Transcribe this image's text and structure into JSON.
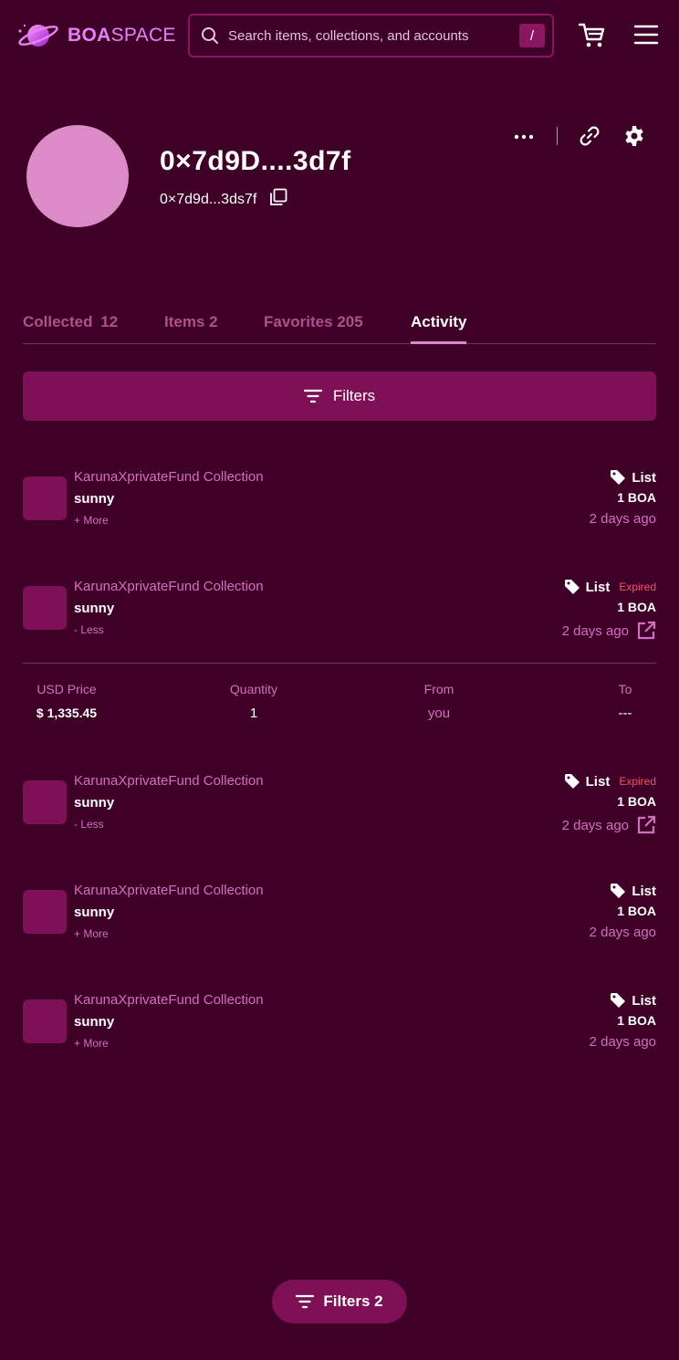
{
  "header": {
    "logo_bold": "BOA",
    "logo_light": "SPACE",
    "search_placeholder": "Search items, collections, and accounts",
    "search_shortcut": "/"
  },
  "profile": {
    "name": "0×7d9D....3d7f",
    "address": "0×7d9d...3ds7f"
  },
  "tabs": [
    {
      "label": "Collected",
      "count": "12"
    },
    {
      "label": "Items",
      "count": "2"
    },
    {
      "label": "Favorites",
      "count": "205"
    },
    {
      "label": "Activity",
      "count": ""
    }
  ],
  "filters_label": "Filters",
  "activity": [
    {
      "collection": "KarunaXprivateFund Collection",
      "name": "sunny",
      "toggle": "+ More",
      "event": "List",
      "status": "",
      "price": "1 BOA",
      "time": "2 days ago"
    },
    {
      "collection": "KarunaXprivateFund Collection",
      "name": "sunny",
      "toggle": "- Less",
      "event": "List",
      "status": "Expired",
      "price": "1 BOA",
      "time": "2 days ago"
    },
    {
      "collection": "KarunaXprivateFund Collection",
      "name": "sunny",
      "toggle": "- Less",
      "event": "List",
      "status": "Expired",
      "price": "1 BOA",
      "time": "2 days ago"
    },
    {
      "collection": "KarunaXprivateFund Collection",
      "name": "sunny",
      "toggle": "+ More",
      "event": "List",
      "status": "",
      "price": "1 BOA",
      "time": "2 days ago"
    },
    {
      "collection": "KarunaXprivateFund Collection",
      "name": "sunny",
      "toggle": "+ More",
      "event": "List",
      "status": "",
      "price": "1 BOA",
      "time": "2 days ago"
    }
  ],
  "detail": {
    "usd_price_label": "USD Price",
    "usd_price_value": "$ 1,335.45",
    "quantity_label": "Quantity",
    "quantity_value": "1",
    "from_label": "From",
    "from_value": "you",
    "to_label": "To",
    "to_value": "---"
  },
  "floating_filters_label": "Filters 2",
  "colors": {
    "background": "#3f0027",
    "accent": "#7e1056",
    "pink_text": "#d36fc1",
    "expired": "#ff4d6a"
  }
}
